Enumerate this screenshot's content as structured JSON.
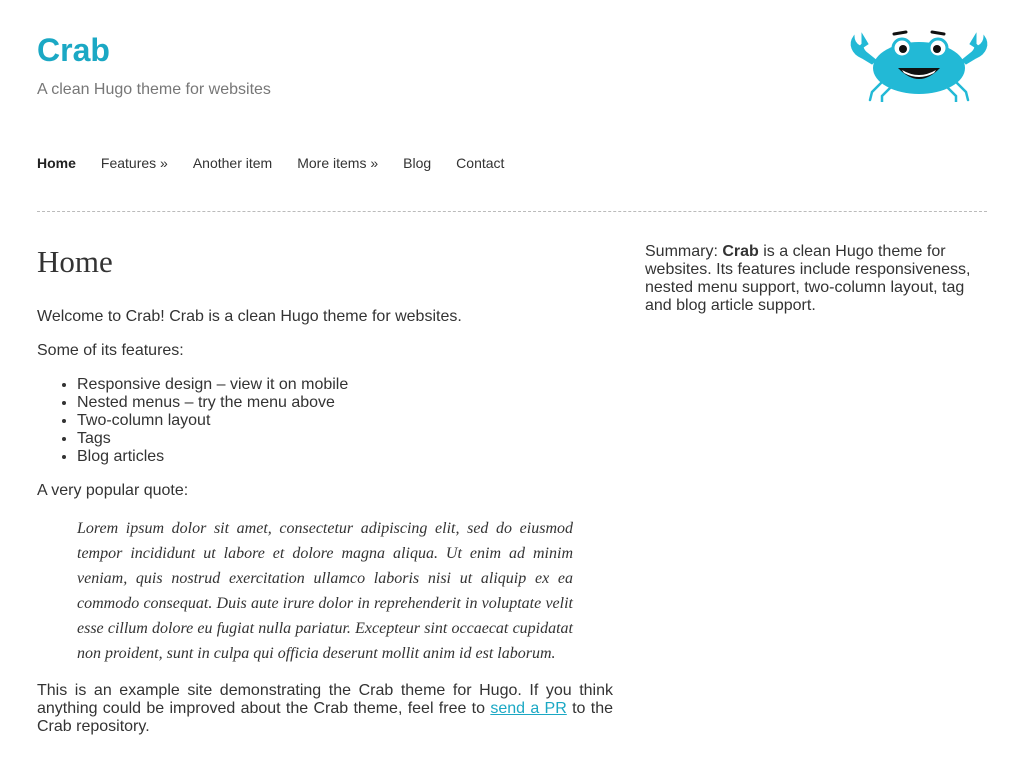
{
  "header": {
    "title": "Crab",
    "tagline": "A clean Hugo theme for websites",
    "logo_icon": "crab-icon",
    "brand_color": "#1ba8c4"
  },
  "nav": {
    "items": [
      {
        "label": "Home",
        "active": true
      },
      {
        "label": "Features »"
      },
      {
        "label": "Another item"
      },
      {
        "label": "More items »"
      },
      {
        "label": "Blog"
      },
      {
        "label": "Contact"
      }
    ]
  },
  "main": {
    "heading": "Home",
    "intro": "Welcome to Crab! Crab is a clean Hugo theme for websites.",
    "features_intro": "Some of its features:",
    "features": [
      "Responsive design – view it on mobile",
      "Nested menus – try the menu above",
      "Two-column layout",
      "Tags",
      "Blog articles"
    ],
    "quote_intro": "A very popular quote:",
    "quote": "Lorem ipsum dolor sit amet, consectetur adipiscing elit, sed do eiusmod tempor incididunt ut labore et dolore magna aliqua. Ut enim ad minim veniam, quis nostrud exercitation ullamco laboris nisi ut aliquip ex ea commodo consequat. Duis aute irure dolor in reprehenderit in voluptate velit esse cillum dolore eu fugiat nulla pariatur. Excepteur sint occaecat cupidatat non proident, sunt in culpa qui officia deserunt mollit anim id est laborum.",
    "closing_before": "This is an example site demonstrating the Crab theme for Hugo. If you think anything could be improved about the Crab theme, feel free to ",
    "closing_link": "send a PR",
    "closing_after": " to the Crab repository."
  },
  "sidebar": {
    "summary_label": "Summary: ",
    "summary_bold": "Crab",
    "summary_text": " is a clean Hugo theme for websites. Its features include responsiveness, nested menu support, two-column layout, tag and blog article support."
  }
}
